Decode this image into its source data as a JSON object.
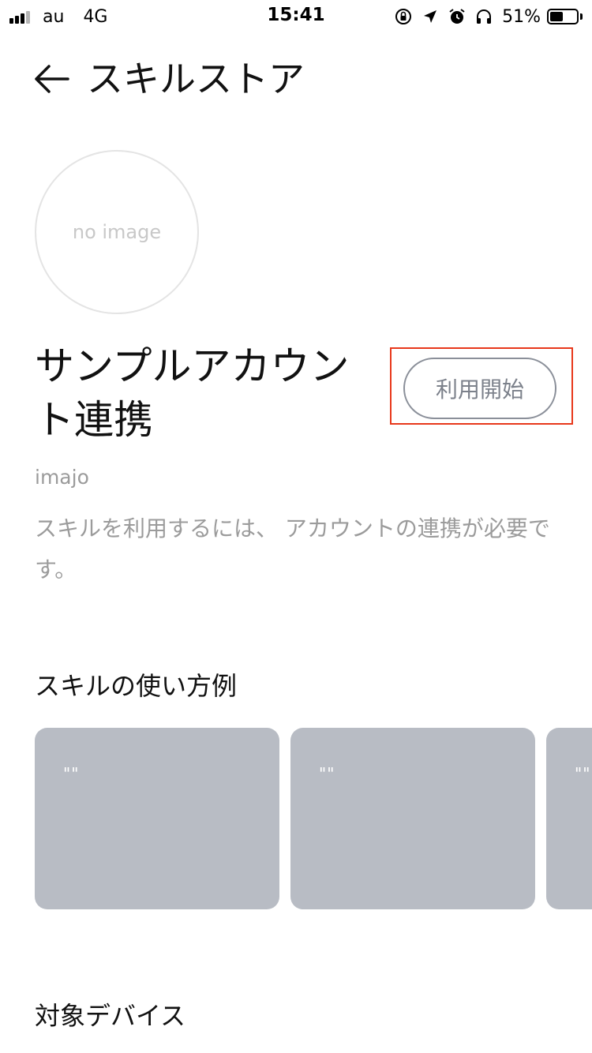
{
  "status_bar": {
    "carrier": "au",
    "network": "4G",
    "time": "15:41",
    "battery_percent": "51%",
    "battery_level": 0.51,
    "signal_bars_active": 3,
    "signal_bars_total": 4,
    "icons": [
      "orientation-lock-icon",
      "location-arrow-icon",
      "alarm-icon",
      "headphones-icon"
    ]
  },
  "nav": {
    "back_icon": "arrow-left-icon",
    "title": "スキルストア"
  },
  "skill": {
    "image_placeholder": "no image",
    "title": "サンプルアカウント連携",
    "start_button_label": "利用開始",
    "developer": "imajo",
    "description": "スキルを利用するには、 アカウントの連携が必要です。"
  },
  "sections": {
    "examples_title": "スキルの使い方例",
    "devices_title": "対象デバイス"
  },
  "examples": [
    {
      "quote": "\"\""
    },
    {
      "quote": "\"\""
    },
    {
      "quote": "\"\""
    }
  ],
  "colors": {
    "highlight_border": "#e8381b",
    "card_background": "#b8bcc4",
    "muted_text": "#9b9b9b",
    "button_border": "#8a8f99"
  }
}
